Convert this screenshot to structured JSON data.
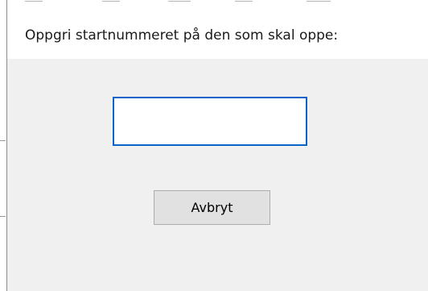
{
  "dialog": {
    "prompt": "Oppgri startnummeret på den som skal oppe:",
    "input": {
      "value": "",
      "placeholder": ""
    },
    "cancel_label": "Avbryt"
  },
  "colors": {
    "background": "#f0f0f0",
    "header_background": "#ffffff",
    "input_focus_border": "#0a64c8",
    "button_background": "#e1e1e1",
    "button_border": "#adadad"
  }
}
